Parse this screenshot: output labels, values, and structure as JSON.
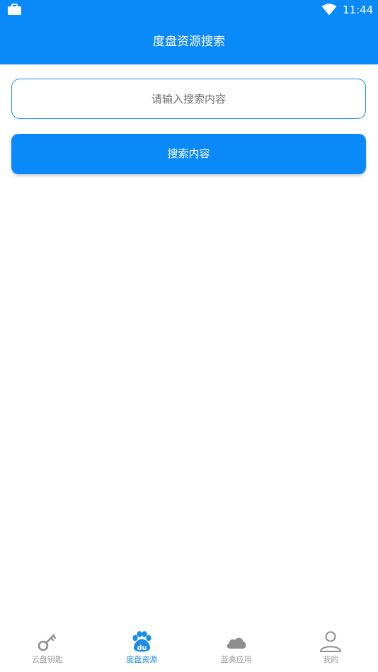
{
  "status_bar": {
    "time": "11:44",
    "left_icon": "briefcase-icon",
    "right_icon": "wifi-icon"
  },
  "header": {
    "title": "度盘资源搜索"
  },
  "search": {
    "placeholder": "请输入搜索内容",
    "value": "",
    "button_label": "搜索内容"
  },
  "bottom_nav": {
    "items": [
      {
        "label": "云盘钥匙",
        "icon": "key-icon",
        "active": false
      },
      {
        "label": "度盘资源",
        "icon": "baidu-paw-icon",
        "active": true
      },
      {
        "label": "蓝奏应用",
        "icon": "cloud-icon",
        "active": false
      },
      {
        "label": "我的",
        "icon": "user-icon",
        "active": false
      }
    ]
  },
  "colors": {
    "primary": "#0a89f8",
    "active_nav": "#1a8ee6",
    "inactive_nav": "#9b9b9b",
    "background": "#ffffff"
  }
}
